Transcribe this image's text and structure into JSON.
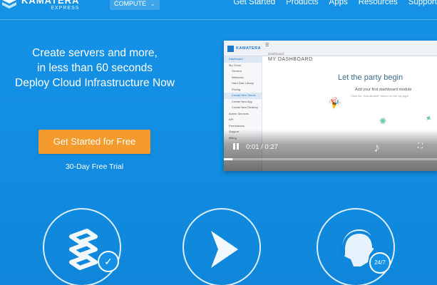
{
  "header": {
    "brand_name": "KAMATERA",
    "brand_sub": "EXPRESS",
    "compute_label": "COMPUTE",
    "nav": [
      "Get Started",
      "Products",
      "Apps",
      "Resources",
      "Support"
    ]
  },
  "hero": {
    "line1": "Create servers and more,",
    "line2": "in less than 60 seconds",
    "line3": "Deploy Cloud Infrastructure Now",
    "cta_label": "Get Started for Free",
    "trial_label": "30-Day Free Trial"
  },
  "video": {
    "app_brand": "KAMATERA",
    "breadcrumb": "Dashboard",
    "dashboard_title": "MY DASHBOARD",
    "headline": "Let the party begin",
    "subline": "Add your first dashboard module",
    "hint": "Click the \"Add Module\" button on the top right",
    "sidebar": [
      "Dashboard",
      "My Cloud",
      "Servers",
      "Networks",
      "Hard Disk Library",
      "Pricing",
      "Create New Server",
      "Create New App",
      "Create New Desktop",
      "Admin Services",
      "API",
      "Permissions",
      "Support",
      "Billing"
    ],
    "time": "0:01 / 0:27",
    "progress": 0.04
  },
  "features": {
    "badge_hours": "24/7",
    "check_icon": "check-icon"
  },
  "colors": {
    "background": "#1592e6",
    "cta": "#f59a2c"
  }
}
